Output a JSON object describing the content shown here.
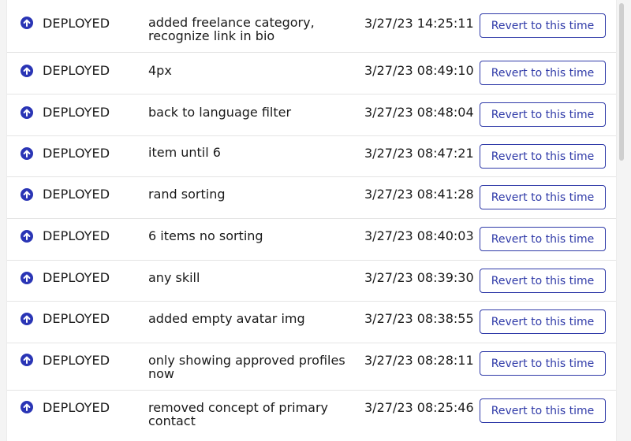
{
  "deployments": [
    {
      "status": "DEPLOYED",
      "message": "added freelance category, recognize link in bio",
      "time": "3/27/23 14:25:11",
      "action": "Revert to this time"
    },
    {
      "status": "DEPLOYED",
      "message": "4px",
      "time": "3/27/23 08:49:10",
      "action": "Revert to this time"
    },
    {
      "status": "DEPLOYED",
      "message": "back to language filter",
      "time": "3/27/23 08:48:04",
      "action": "Revert to this time"
    },
    {
      "status": "DEPLOYED",
      "message": "item until 6",
      "time": "3/27/23 08:47:21",
      "action": "Revert to this time"
    },
    {
      "status": "DEPLOYED",
      "message": "rand sorting",
      "time": "3/27/23 08:41:28",
      "action": "Revert to this time"
    },
    {
      "status": "DEPLOYED",
      "message": "6 items no sorting",
      "time": "3/27/23 08:40:03",
      "action": "Revert to this time"
    },
    {
      "status": "DEPLOYED",
      "message": "any skill",
      "time": "3/27/23 08:39:30",
      "action": "Revert to this time"
    },
    {
      "status": "DEPLOYED",
      "message": "added empty avatar img",
      "time": "3/27/23 08:38:55",
      "action": "Revert to this time"
    },
    {
      "status": "DEPLOYED",
      "message": "only showing approved profiles now",
      "time": "3/27/23 08:28:11",
      "action": "Revert to this time"
    },
    {
      "status": "DEPLOYED",
      "message": "removed concept of primary contact",
      "time": "3/27/23 08:25:46",
      "action": "Revert to this time"
    }
  ],
  "status_icon": "arrow-up-circle-icon",
  "colors": {
    "icon": "#2a35b5",
    "button": "#2f3aa8"
  }
}
